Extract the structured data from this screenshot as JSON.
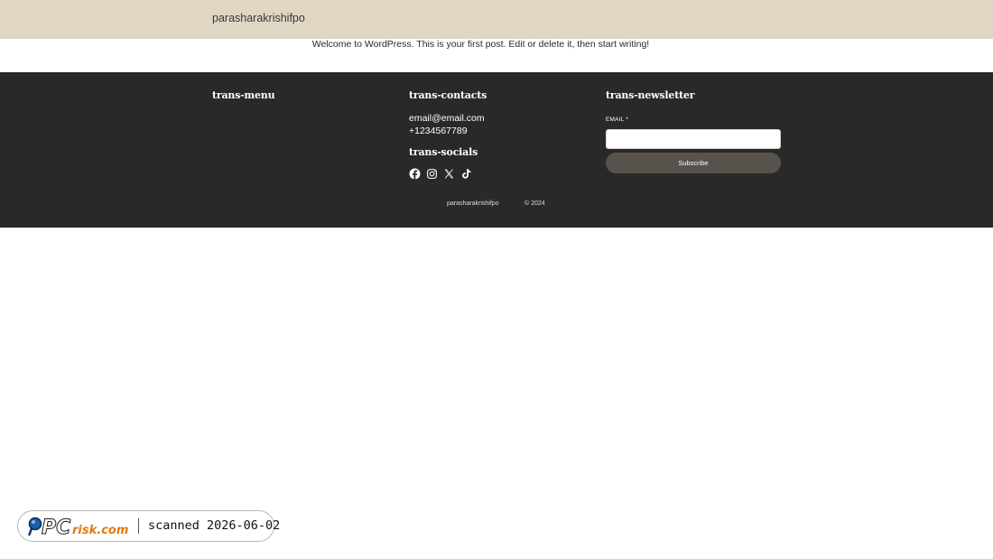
{
  "header": {
    "site_title": "parasharakrishifpo"
  },
  "post": {
    "content": "Welcome to WordPress. This is your first post. Edit or delete it, then start writing!"
  },
  "footer": {
    "menu_heading": "trans-menu",
    "contacts_heading": "trans-contacts",
    "email": "email@email.com",
    "phone": "+1234567789",
    "socials_heading": "trans-socials",
    "socials": [
      {
        "icon": "facebook-icon"
      },
      {
        "icon": "instagram-icon"
      },
      {
        "icon": "x-twitter-icon"
      },
      {
        "icon": "tiktok-icon"
      }
    ],
    "newsletter_heading": "trans-newsletter",
    "email_label": "EMAIL *",
    "email_value": "",
    "subscribe_label": "Subscribe",
    "copyright_site": "parasharakrishifpo",
    "copyright_year": "© 2024"
  },
  "badge": {
    "logo_text": "PCrisk.com",
    "scan_text": "scanned 2026-06-02"
  },
  "colors": {
    "header_bg": "#e0d6c4",
    "footer_bg": "#2a2927",
    "button_bg": "#57524c",
    "badge_orange": "#e07a12",
    "badge_blue": "#1d5fa8"
  }
}
